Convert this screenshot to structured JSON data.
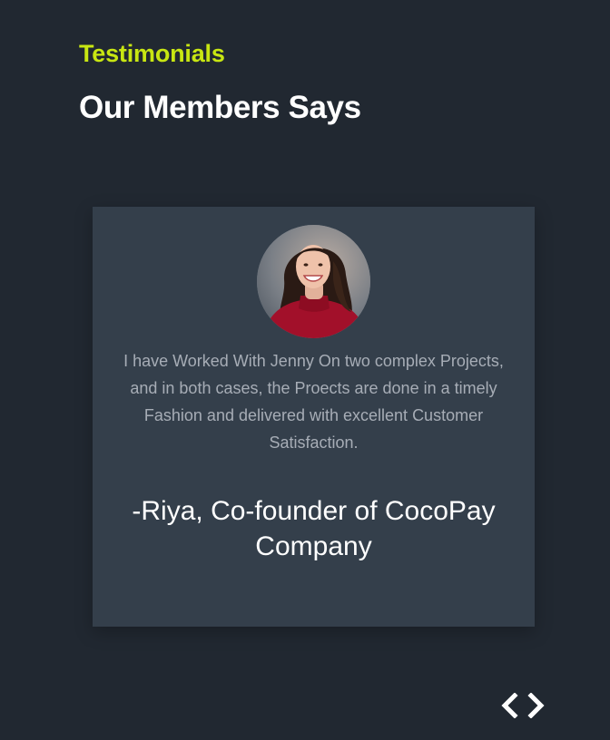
{
  "section": {
    "eyebrow": "Testimonials",
    "title": "Our Members Says"
  },
  "testimonial": {
    "quote": "I have Worked With Jenny On two complex Projects, and in both cases, the Proects are done in a timely Fashion and delivered with excellent Customer Satisfaction.",
    "author": "-Riya, Co-founder of CocoPay Company",
    "avatar_icon": "person-photo"
  },
  "navigation": {
    "prev_icon": "chevron-left-icon",
    "next_icon": "chevron-right-icon"
  },
  "colors": {
    "background": "#212831",
    "card": "#343f4b",
    "accent": "#c8e612",
    "heading": "#ffffff",
    "quote_text": "#a7adb6"
  }
}
